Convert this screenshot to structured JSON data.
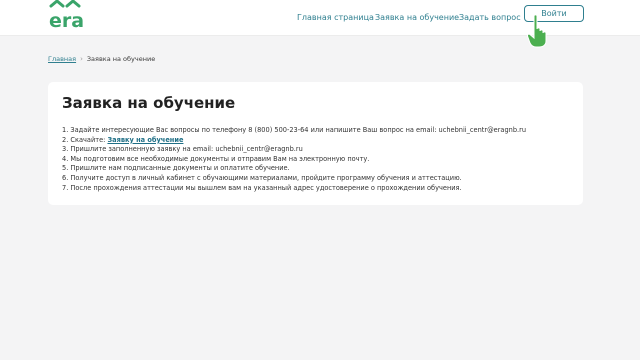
{
  "header": {
    "logo_text": "era",
    "nav": {
      "home": "Главная страница",
      "apply": "Заявка на обучение",
      "ask": "Задать вопрос"
    },
    "login_label": "Войти"
  },
  "breadcrumb": {
    "home": "Главная",
    "separator": "›",
    "current": "Заявка на обучение"
  },
  "main": {
    "title": "Заявка на обучение",
    "steps": [
      "1. Задайте интересующие Вас вопросы по телефону 8 (800) 500-23-64 или напишите Ваш вопрос на email: uchebnii_centr@eragnb.ru",
      "2. Скачайте: ",
      "3. Пришлите заполненную заявку на email: uchebnii_centr@eragnb.ru",
      "4. Мы подготовим все необходимые документы и отправим Вам на электронную почту.",
      "5. Пришлите нам подписанные документы и оплатите обучение.",
      "6. Получите доступ в личный кабинет с обучающими материалами, пройдите программу обучения и аттестацию.",
      "7. После прохождения аттестации мы вышлем вам на указанный адрес удостоверение о прохождении обучения."
    ],
    "download_link": "Заявку на обучение"
  },
  "colors": {
    "accent": "#2f7f8f",
    "logo_green": "#3aa46a",
    "cursor_green": "#4caf50",
    "background": "#f4f4f5"
  }
}
